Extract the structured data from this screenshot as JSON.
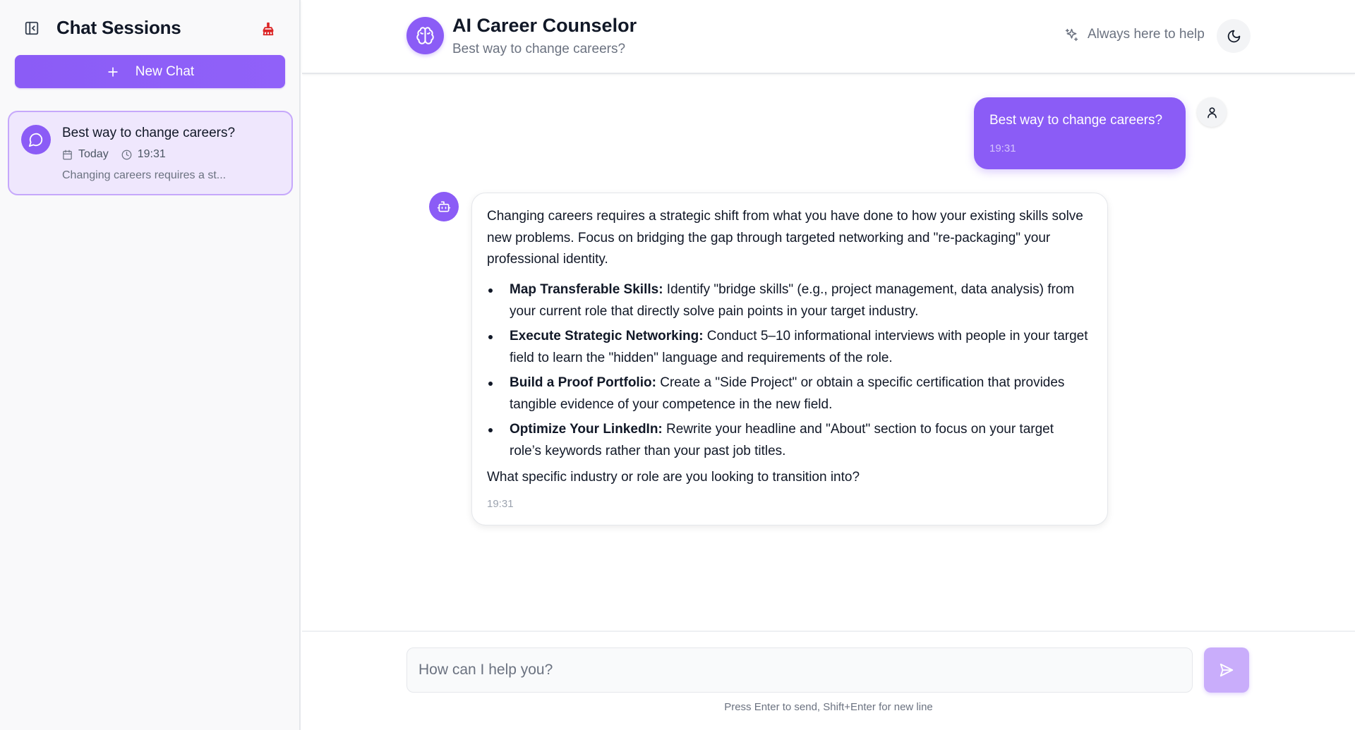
{
  "colors": {
    "accent": "#8b5cf6",
    "danger_icon": "#dc2626",
    "session_bg": "#efe7fd"
  },
  "sidebar": {
    "title": "Chat Sessions",
    "toggle_icon": "panel-left-close-icon",
    "clear_icon": "broom-icon",
    "new_chat_label": "New Chat",
    "sessions": [
      {
        "title": "Best way to change careers?",
        "date": "Today",
        "time": "19:31",
        "preview": "Changing careers requires a st..."
      }
    ]
  },
  "header": {
    "title": "AI Career Counselor",
    "subtitle": "Best way to change careers?",
    "status": "Always here to help",
    "brand_icon": "brain-icon",
    "theme_icon": "moon-icon"
  },
  "messages": {
    "user": {
      "text": "Best way to change careers?",
      "time": "19:31"
    },
    "bot": {
      "intro": "Changing careers requires a strategic shift from what you have done to how your existing skills solve new problems. Focus on bridging the gap through targeted networking and \"re-packaging\" your professional identity.",
      "bullets": [
        {
          "bold": "Map Transferable Skills:",
          "text": " Identify \"bridge skills\" (e.g., project management, data analysis) from your current role that directly solve pain points in your target industry."
        },
        {
          "bold": "Execute Strategic Networking:",
          "text": " Conduct 5–10 informational interviews with people in your target field to learn the \"hidden\" language and requirements of the role."
        },
        {
          "bold": "Build a Proof Portfolio:",
          "text": " Create a \"Side Project\" or obtain a specific certification that provides tangible evidence of your competence in the new field."
        },
        {
          "bold": "Optimize Your LinkedIn:",
          "text": " Rewrite your headline and \"About\" section to focus on your target role’s keywords rather than your past job titles."
        }
      ],
      "question": "What specific industry or role are you looking to transition into?",
      "time": "19:31"
    }
  },
  "composer": {
    "placeholder": "How can I help you?",
    "value": "",
    "hint": "Press Enter to send, Shift+Enter for new line"
  }
}
